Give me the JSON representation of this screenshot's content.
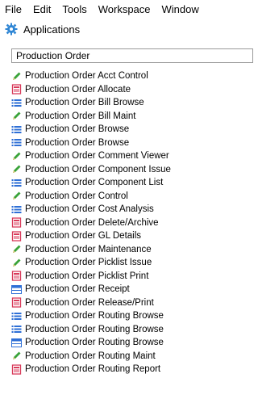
{
  "menubar": {
    "items": [
      "File",
      "Edit",
      "Tools",
      "Workspace",
      "Window"
    ]
  },
  "panel": {
    "title": "Applications",
    "icon": "gear-icon"
  },
  "search": {
    "value": "Production Order"
  },
  "results": [
    {
      "label": "Production Order Acct Control",
      "icon": "pencil-icon"
    },
    {
      "label": "Production Order Allocate",
      "icon": "report-icon"
    },
    {
      "label": "Production Order Bill Browse",
      "icon": "list-icon"
    },
    {
      "label": "Production Order Bill Maint",
      "icon": "pencil-icon"
    },
    {
      "label": "Production Order Browse",
      "icon": "list-icon"
    },
    {
      "label": "Production Order Browse",
      "icon": "list-icon"
    },
    {
      "label": "Production Order Comment Viewer",
      "icon": "pencil-icon"
    },
    {
      "label": "Production Order Component Issue",
      "icon": "pencil-icon"
    },
    {
      "label": "Production Order Component List",
      "icon": "list-icon"
    },
    {
      "label": "Production Order Control",
      "icon": "pencil-icon"
    },
    {
      "label": "Production Order Cost Analysis",
      "icon": "list-icon"
    },
    {
      "label": "Production Order Delete/Archive",
      "icon": "report-icon"
    },
    {
      "label": "Production Order GL Details",
      "icon": "report-icon"
    },
    {
      "label": "Production Order Maintenance",
      "icon": "pencil-icon"
    },
    {
      "label": "Production Order Picklist Issue",
      "icon": "pencil-icon"
    },
    {
      "label": "Production Order Picklist Print",
      "icon": "report-icon"
    },
    {
      "label": "Production Order Receipt",
      "icon": "table-icon"
    },
    {
      "label": "Production Order Release/Print",
      "icon": "report-icon"
    },
    {
      "label": "Production Order Routing Browse",
      "icon": "list-icon"
    },
    {
      "label": "Production Order Routing Browse",
      "icon": "list-icon"
    },
    {
      "label": "Production Order Routing Browse",
      "icon": "table-icon"
    },
    {
      "label": "Production Order Routing Maint",
      "icon": "pencil-icon"
    },
    {
      "label": "Production Order Routing Report",
      "icon": "report-icon"
    }
  ],
  "colors": {
    "pencil": "#3aa33a",
    "report": "#d83a5a",
    "list": "#2e6fd6",
    "gear": "#2f86d4"
  }
}
